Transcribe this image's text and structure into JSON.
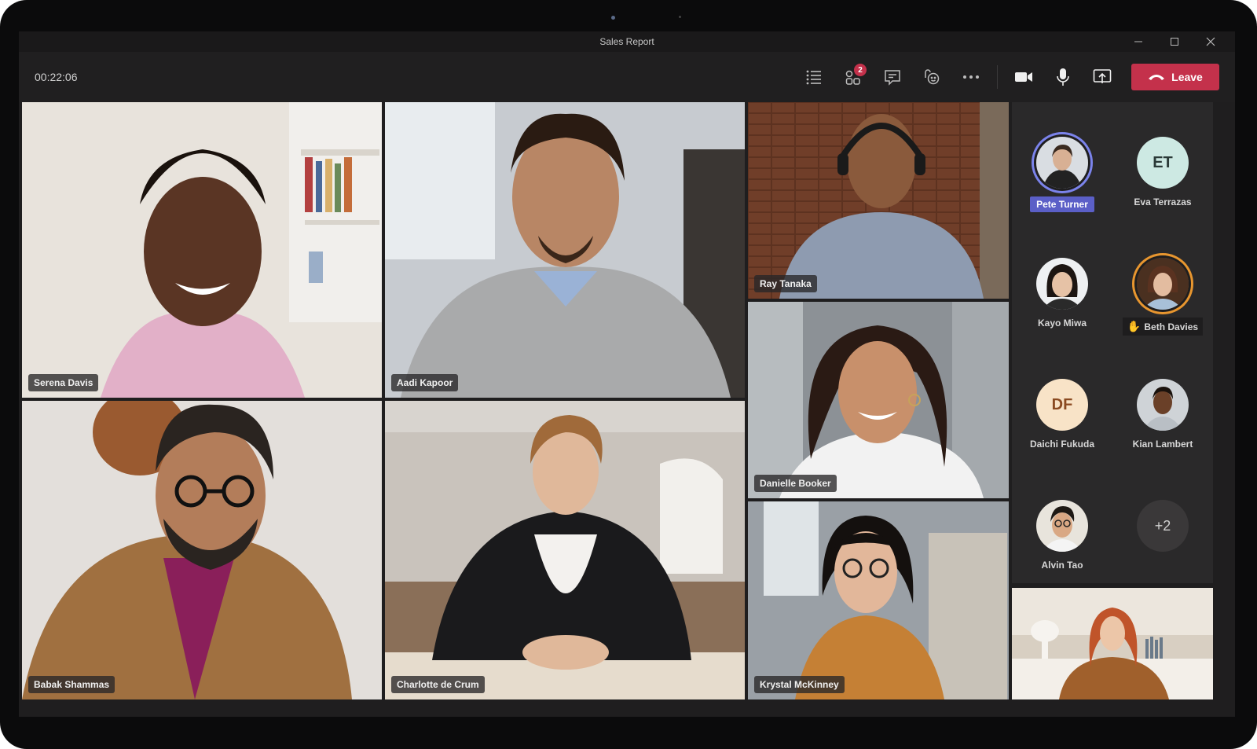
{
  "window": {
    "title": "Sales Report",
    "controls": {
      "minimize": "minimize-icon",
      "maximize": "maximize-icon",
      "close": "close-icon"
    }
  },
  "toolbar": {
    "call_timer": "00:22:06",
    "tools": [
      {
        "name": "participants-list",
        "icon": "list-icon"
      },
      {
        "name": "breakout-rooms",
        "icon": "apps-icon",
        "badge": "2"
      },
      {
        "name": "chat",
        "icon": "chat-icon"
      },
      {
        "name": "reactions",
        "icon": "reactions-icon"
      },
      {
        "name": "more-actions",
        "icon": "more-icon"
      }
    ],
    "media": [
      {
        "name": "camera",
        "icon": "video-camera-icon"
      },
      {
        "name": "microphone",
        "icon": "microphone-icon"
      },
      {
        "name": "share-screen",
        "icon": "share-screen-icon"
      }
    ],
    "leave_label": "Leave",
    "leave_color": "#c4314b",
    "badge_color": "#c4314b"
  },
  "video_tiles": [
    {
      "name": "Serena Davis"
    },
    {
      "name": "Aadi Kapoor"
    },
    {
      "name": "Ray Tanaka"
    },
    {
      "name": "Danielle Booker"
    },
    {
      "name": "Babak Shammas"
    },
    {
      "name": "Charlotte de Crum"
    },
    {
      "name": "Krystal McKinney"
    }
  ],
  "roster": {
    "members": [
      {
        "name": "Pete Turner",
        "type": "photo",
        "state": "speaking",
        "ring_color": "#7b83eb"
      },
      {
        "name": "Eva Terrazas",
        "type": "initials",
        "initials": "ET",
        "bg": "#cde9e3",
        "fg": "#2b3a38"
      },
      {
        "name": "Kayo Miwa",
        "type": "photo"
      },
      {
        "name": "Beth Davies",
        "type": "photo",
        "state": "hand-raised",
        "ring_color": "#e8962f"
      },
      {
        "name": "Daichi Fukuda",
        "type": "initials",
        "initials": "DF",
        "bg": "#f8e3c7",
        "fg": "#8a4a21"
      },
      {
        "name": "Kian Lambert",
        "type": "photo"
      },
      {
        "name": "Alvin Tao",
        "type": "photo"
      }
    ],
    "overflow_label": "+2"
  },
  "self_view": {
    "label": "self-video-preview"
  }
}
